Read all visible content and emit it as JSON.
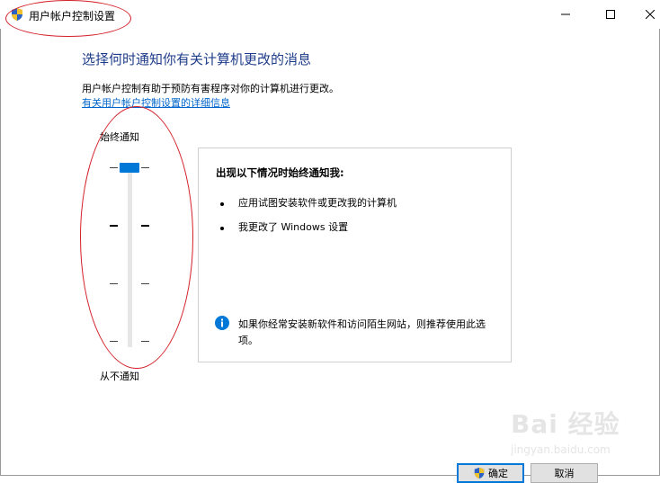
{
  "window": {
    "title": "用户帐户控制设置",
    "minimize_symbol": "—",
    "maximize_symbol": "☐",
    "close_symbol": "✕"
  },
  "main": {
    "heading": "选择何时通知你有关计算机更改的消息",
    "description": "用户帐户控制有助于预防有害程序对你的计算机进行更改。",
    "link": "有关用户帐户控制设置的详细信息"
  },
  "slider": {
    "label_top": "始终通知",
    "label_bottom": "从不通知",
    "levels": 4,
    "current_level": 4
  },
  "panel": {
    "title": "出现以下情况时始终通知我:",
    "bullets": [
      "应用试图安装软件或更改我的计算机",
      "我更改了 Windows 设置"
    ],
    "info": "如果你经常安装新软件和访问陌生网站，则推荐使用此选项。"
  },
  "buttons": {
    "ok": "确定",
    "cancel": "取消"
  },
  "watermark": {
    "text": "Bai 经验",
    "url": "jingyan.baidu.com"
  },
  "colors": {
    "heading": "#1f3d8a",
    "link": "#0066cc",
    "accent": "#0078d7",
    "annotation": "#d42028"
  }
}
